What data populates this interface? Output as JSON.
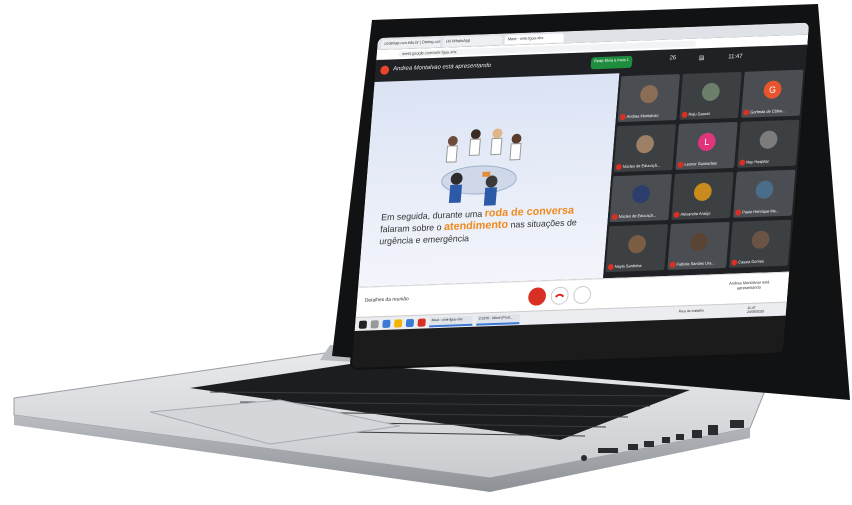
{
  "browser": {
    "tabs": [
      "cederiap.ucs.edu.br | Dering.com Google",
      "(4) WhatsApp",
      "Meet - wnk-fguu-xhx"
    ],
    "url": "meet.google.com/wnk-fguu-xhx"
  },
  "meet": {
    "presenter_text": "Andrea Montalvao está apresentando",
    "recording_text": "Reap Elvia e mais 1",
    "people_count": "26",
    "time": "11:47",
    "slide": {
      "caption_pre": "Em seguida, durante uma ",
      "caption_hl1": "roda de conversa",
      "caption_mid": " falaram sobre o ",
      "caption_hl2": "atendimento",
      "caption_post": " nas situações de urgência e emergência"
    },
    "participants": [
      {
        "name": "Andrea Montalvao",
        "initial": "",
        "color": "#8a6d55"
      },
      {
        "name": "Reju Gaurat",
        "initial": "",
        "color": "#6b7f6a"
      },
      {
        "name": "Gorfesta de Câfrei...",
        "initial": "G",
        "color": "#e8542c"
      },
      {
        "name": "Núcleo de Educaçã...",
        "initial": "",
        "color": "#9d7f66"
      },
      {
        "name": "Leonor Guimarães",
        "initial": "L",
        "color": "#e0357a"
      },
      {
        "name": "Ney Hospital",
        "initial": "",
        "color": "#7c7c7c"
      },
      {
        "name": "Núcleo de Educaçã...",
        "initial": "",
        "color": "#2c3e6b"
      },
      {
        "name": "Alexandre Araújo",
        "initial": "",
        "color": "#c98b1b"
      },
      {
        "name": "Paulo Henrique Me...",
        "initial": "",
        "color": "#4a6e8a"
      },
      {
        "name": "Nayla Sardinha",
        "initial": "",
        "color": "#7b5d44"
      },
      {
        "name": "Fabíola Sandes Ura...",
        "initial": "",
        "color": "#5a4535"
      },
      {
        "name": "Cassia Gomes",
        "initial": "",
        "color": "#6b5346"
      }
    ],
    "details_label": "Detalhes da reunião",
    "presenting_label": "Andrea Montalvao está apresentando"
  },
  "taskbar": {
    "windows": [
      "Meet - wnk-fguu-xhx",
      "CS370 - Word (Prod..."
    ],
    "tray_text": "Área de trabalho",
    "clock_time": "11:47",
    "clock_date": "24/09/2020"
  }
}
